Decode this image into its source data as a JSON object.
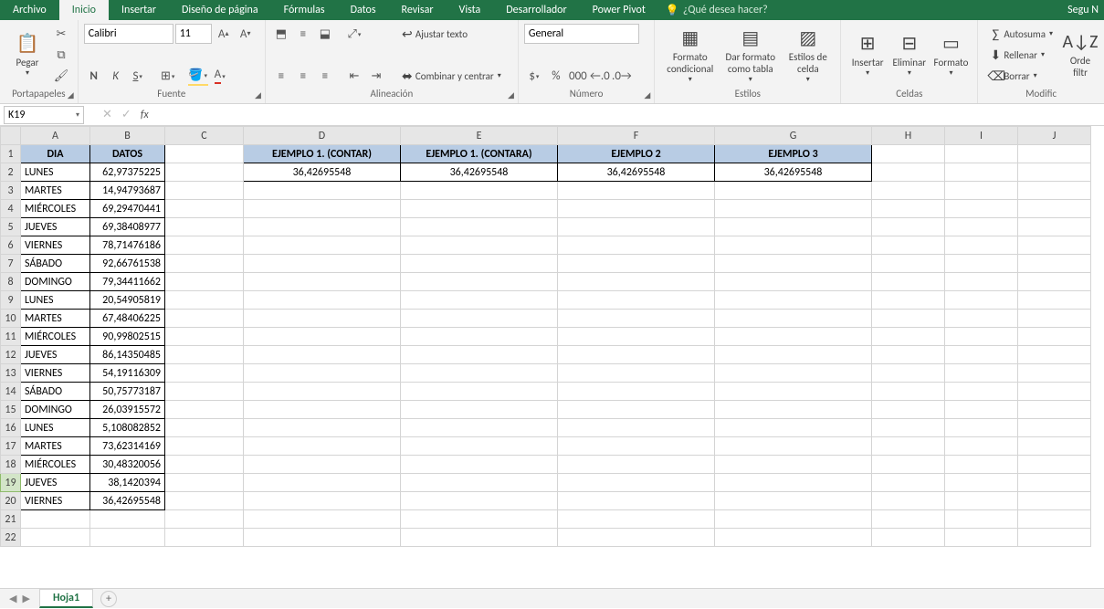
{
  "menu": {
    "tabs": [
      "Archivo",
      "Inicio",
      "Insertar",
      "Diseño de página",
      "Fórmulas",
      "Datos",
      "Revisar",
      "Vista",
      "Desarrollador",
      "Power Pivot"
    ],
    "active": 1,
    "search_placeholder": "¿Qué desea hacer?",
    "right": "Segu N"
  },
  "ribbon": {
    "portapapeles": {
      "label": "Portapapeles",
      "pegar": "Pegar"
    },
    "fuente": {
      "label": "Fuente",
      "font": "Calibri",
      "size": "11"
    },
    "alineacion": {
      "label": "Alineación",
      "ajustar": "Ajustar texto",
      "combinar": "Combinar y centrar"
    },
    "numero": {
      "label": "Número",
      "fmt": "General"
    },
    "estilos": {
      "label": "Estilos",
      "cond": "Formato condicional",
      "tabla": "Dar formato como tabla",
      "celda": "Estilos de celda"
    },
    "celdas": {
      "label": "Celdas",
      "insertar": "Insertar",
      "eliminar": "Eliminar",
      "formato": "Formato"
    },
    "modificar": {
      "label": "Modific",
      "autosuma": "Autosuma",
      "rellenar": "Rellenar",
      "borrar": "Borrar",
      "orden": "Orde filtr"
    }
  },
  "namebox": "K19",
  "cols": [
    "A",
    "B",
    "C",
    "D",
    "E",
    "F",
    "G",
    "H",
    "I",
    "J"
  ],
  "headers": {
    "dia": "DIA",
    "datos": "DATOS",
    "e1c": "EJEMPLO 1. (CONTAR)",
    "e1ca": "EJEMPLO 1. (CONTARA)",
    "e2": "EJEMPLO 2",
    "e3": "EJEMPLO 3"
  },
  "valrow": {
    "d": "36,42695548",
    "e": "36,42695548",
    "f": "36,42695548",
    "g": "36,42695548"
  },
  "rows": [
    {
      "n": 2,
      "dia": "LUNES",
      "v": "62,97375225"
    },
    {
      "n": 3,
      "dia": "MARTES",
      "v": "14,94793687"
    },
    {
      "n": 4,
      "dia": "MIÉRCOLES",
      "v": "69,29470441"
    },
    {
      "n": 5,
      "dia": "JUEVES",
      "v": "69,38408977"
    },
    {
      "n": 6,
      "dia": "VIERNES",
      "v": "78,71476186"
    },
    {
      "n": 7,
      "dia": "SÁBADO",
      "v": "92,66761538"
    },
    {
      "n": 8,
      "dia": "DOMINGO",
      "v": "79,34411662"
    },
    {
      "n": 9,
      "dia": "LUNES",
      "v": "20,54905819"
    },
    {
      "n": 10,
      "dia": "MARTES",
      "v": "67,48406225"
    },
    {
      "n": 11,
      "dia": "MIÉRCOLES",
      "v": "90,99802515"
    },
    {
      "n": 12,
      "dia": "JUEVES",
      "v": "86,14350485"
    },
    {
      "n": 13,
      "dia": "VIERNES",
      "v": "54,19116309"
    },
    {
      "n": 14,
      "dia": "SÁBADO",
      "v": "50,75773187"
    },
    {
      "n": 15,
      "dia": "DOMINGO",
      "v": "26,03915572"
    },
    {
      "n": 16,
      "dia": "LUNES",
      "v": "5,108082852"
    },
    {
      "n": 17,
      "dia": "MARTES",
      "v": "73,62314169"
    },
    {
      "n": 18,
      "dia": "MIÉRCOLES",
      "v": "30,48320056"
    },
    {
      "n": 19,
      "dia": "JUEVES",
      "v": "38,1420394"
    },
    {
      "n": 20,
      "dia": "VIERNES",
      "v": "36,42695548"
    }
  ],
  "sheet": {
    "name": "Hoja1"
  }
}
